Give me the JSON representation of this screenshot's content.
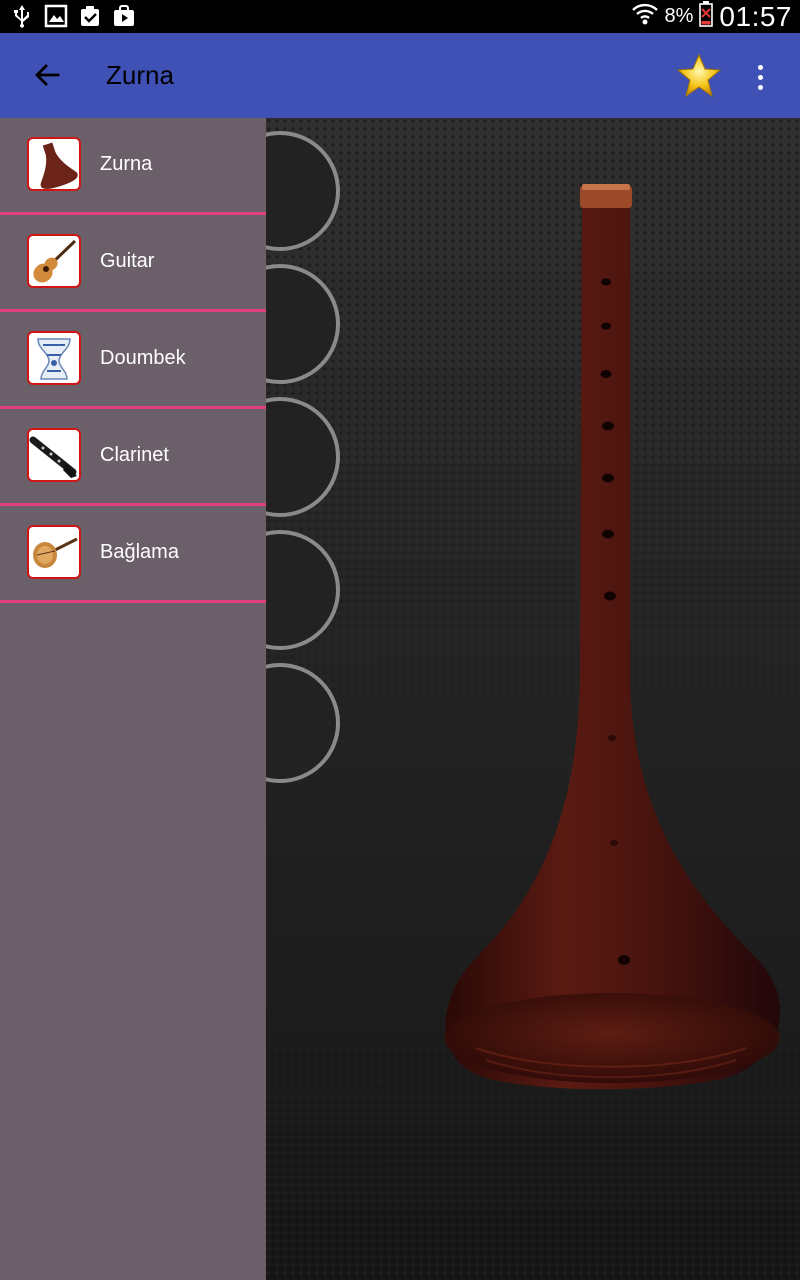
{
  "status_bar": {
    "battery_percent": "8%",
    "time": "01:57",
    "left_icons": [
      "usb-icon",
      "image-icon",
      "clipboard-check-icon",
      "play-store-icon"
    ],
    "right_icons": [
      "wifi-icon",
      "battery-low-icon"
    ]
  },
  "app_bar": {
    "title": "Zurna",
    "back_icon": "arrow-back-icon",
    "favorite_icon": "star-icon",
    "overflow_icon": "more-vertical-icon",
    "background_color": "#3f51b5"
  },
  "drawer": {
    "background_color": "#6b5f69",
    "divider_color": "#e0417c",
    "items": [
      {
        "label": "Zurna",
        "icon": "zurna-thumb"
      },
      {
        "label": "Guitar",
        "icon": "guitar-thumb"
      },
      {
        "label": "Doumbek",
        "icon": "doumbek-thumb"
      },
      {
        "label": "Clarinet",
        "icon": "clarinet-thumb"
      },
      {
        "label": "Bağlama",
        "icon": "baglama-thumb"
      }
    ]
  }
}
